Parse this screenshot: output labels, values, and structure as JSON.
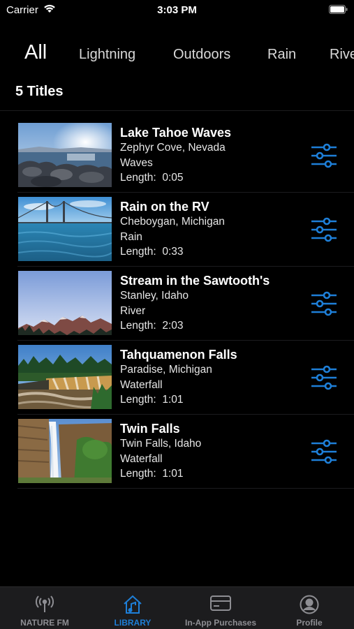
{
  "status_bar": {
    "carrier": "Carrier",
    "time": "3:03 PM"
  },
  "categories": [
    "All",
    "Lightning",
    "Outdoors",
    "Rain",
    "Rive"
  ],
  "active_category": "All",
  "titles_count": "5 Titles",
  "length_label": "Length:",
  "items": [
    {
      "title": "Lake Tahoe Waves",
      "location": "Zephyr Cove, Nevada",
      "type": "Waves",
      "length": "0:05"
    },
    {
      "title": "Rain on the RV",
      "location": "Cheboygan, Michigan",
      "type": "Rain",
      "length": "0:33"
    },
    {
      "title": "Stream in the Sawtooth's",
      "location": "Stanley, Idaho",
      "type": "River",
      "length": "2:03"
    },
    {
      "title": "Tahquamenon Falls",
      "location": "Paradise, Michigan",
      "type": "Waterfall",
      "length": "1:01"
    },
    {
      "title": "Twin Falls",
      "location": "Twin Falls, Idaho",
      "type": "Waterfall",
      "length": "1:01"
    }
  ],
  "tab_bar": [
    {
      "label": "NATURE FM",
      "icon": "radio-tower-icon",
      "active": false
    },
    {
      "label": "LIBRARY",
      "icon": "home-music-icon",
      "active": true
    },
    {
      "label": "In-App Purchases",
      "icon": "credit-card-icon",
      "active": false
    },
    {
      "label": "Profile",
      "icon": "profile-icon",
      "active": false
    }
  ],
  "colors": {
    "accent": "#1e7fd8",
    "background": "#000000",
    "tab_bar": "#1c1c1e",
    "inactive": "#8e8e93"
  }
}
